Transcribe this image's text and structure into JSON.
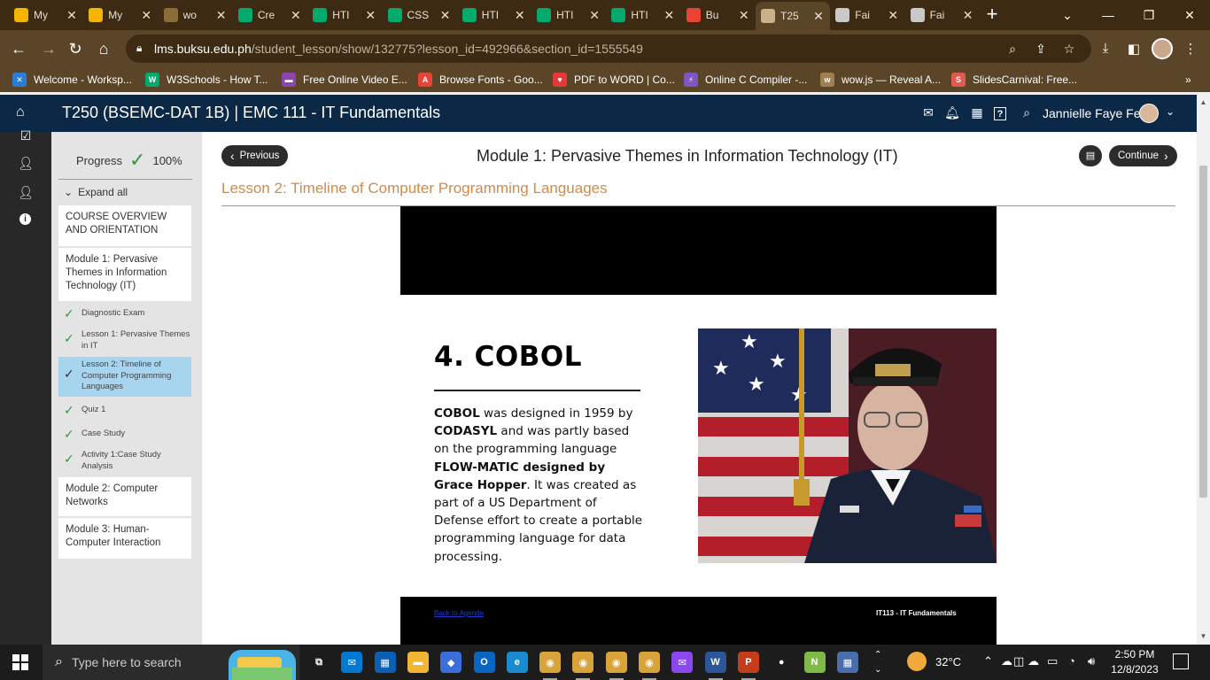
{
  "browser": {
    "tabs": [
      {
        "label": "My",
        "icon": "drive",
        "color": "#f4b400"
      },
      {
        "label": "My",
        "icon": "drive",
        "color": "#f4b400"
      },
      {
        "label": "wo",
        "icon": "image",
        "color": "#8a6d3b"
      },
      {
        "label": "Cre",
        "icon": "w3schools",
        "color": "#04aa6d"
      },
      {
        "label": "HTI",
        "icon": "w3schools",
        "color": "#04aa6d"
      },
      {
        "label": "CSS",
        "icon": "w3schools",
        "color": "#04aa6d"
      },
      {
        "label": "HTI",
        "icon": "w3schools",
        "color": "#04aa6d"
      },
      {
        "label": "HTI",
        "icon": "w3schools",
        "color": "#04aa6d"
      },
      {
        "label": "HTI",
        "icon": "w3schools",
        "color": "#04aa6d"
      },
      {
        "label": "Bu",
        "icon": "gmail",
        "color": "#ea4335"
      },
      {
        "label": "T25",
        "icon": "lms",
        "color": "#c9b28a"
      },
      {
        "label": "Fai",
        "icon": "globe",
        "color": "#c9c9c9"
      },
      {
        "label": "Fai",
        "icon": "globe",
        "color": "#c9c9c9"
      }
    ],
    "active_tab_index": 10,
    "new_tab": "+",
    "url_host": "lms.buksu.edu.ph",
    "url_path": "/student_lesson/show/132775?lesson_id=492966&section_id=1555549",
    "bookmarks": [
      {
        "label": "Welcome - Worksp...",
        "color": "#2b7cd3",
        "glyph": "✕"
      },
      {
        "label": "W3Schools - How T...",
        "color": "#04aa6d",
        "glyph": "W"
      },
      {
        "label": "Free Online Video E...",
        "color": "#8e44ad",
        "glyph": "▬"
      },
      {
        "label": "Browse Fonts - Goo...",
        "color": "#ea4335",
        "glyph": "A"
      },
      {
        "label": "PDF to WORD | Co...",
        "color": "#e53935",
        "glyph": "♥"
      },
      {
        "label": "Online C Compiler -...",
        "color": "#7e57c2",
        "glyph": "⚡"
      },
      {
        "label": "wow.js — Reveal A...",
        "color": "#a08050",
        "glyph": "w"
      },
      {
        "label": "SlidesCarnival: Free...",
        "color": "#e05a4f",
        "glyph": "S"
      }
    ],
    "more_bookmarks": "»"
  },
  "lms": {
    "course_title": "T250 (BSEMC-DAT 1B) | EMC 111 - IT Fundamentals",
    "user_name": "Jannielle Faye Fe...",
    "progress_label": "Progress",
    "progress_value": "100%",
    "progress_fraction": 1.0,
    "expand_all": "Expand all",
    "modules": [
      {
        "title": "COURSE OVERVIEW AND ORIENTATION"
      },
      {
        "title": "Module 1: Pervasive Themes in Information Technology (IT)"
      },
      {
        "title": "Module 2: Computer Networks"
      },
      {
        "title": "Module 3: Human-Computer Interaction"
      }
    ],
    "lessons": [
      {
        "title": "Diagnostic Exam",
        "done": true
      },
      {
        "title": "Lesson 1: Pervasive Themes in IT",
        "done": true
      },
      {
        "title": "Lesson 2: Timeline of Computer Programming Languages",
        "done": true,
        "current": true
      },
      {
        "title": "Quiz 1",
        "done": true
      },
      {
        "title": "Case Study",
        "done": true
      },
      {
        "title": "Activity 1:Case Study Analysis",
        "done": true
      }
    ],
    "previous": "Previous",
    "continue": "Continue",
    "module_heading": "Module 1: Pervasive Themes in Information Technology (IT)",
    "lesson_heading": "Lesson 2: Timeline of Computer Programming Languages"
  },
  "slide": {
    "heading": "4. COBOL",
    "body_parts": [
      {
        "t": "COBOL",
        "b": true
      },
      {
        "t": " was designed in 1959 by ",
        "b": false
      },
      {
        "t": "CODASYL",
        "b": true
      },
      {
        "t": " and was partly based on the programming language ",
        "b": false
      },
      {
        "t": "FLOW-MATIC designed by Grace Hopper",
        "b": true
      },
      {
        "t": ". It was created as part of a US Department of Defense effort to create a portable programming language for data processing.",
        "b": false
      }
    ],
    "back_link": "Back to Agenda",
    "footer_course": "IT113 - IT Fundamentals"
  },
  "taskbar": {
    "search_placeholder": "Type here to search",
    "temperature": "32°C",
    "time": "2:50 PM",
    "date": "12/8/2023",
    "apps": [
      {
        "name": "task-view",
        "color": "#1c1c1c",
        "glyph": "⧉"
      },
      {
        "name": "mail",
        "color": "#0078d4",
        "glyph": "✉"
      },
      {
        "name": "store",
        "color": "#0a5fb4",
        "glyph": "▦"
      },
      {
        "name": "file-explorer",
        "color": "#f2b632",
        "glyph": "▬"
      },
      {
        "name": "vpn",
        "color": "#3b6ed9",
        "glyph": "◆"
      },
      {
        "name": "outlook",
        "color": "#0a64c2",
        "glyph": "O"
      },
      {
        "name": "edge",
        "color": "#1a8bd0",
        "glyph": "e"
      },
      {
        "name": "chrome",
        "color": "#d9a33b",
        "glyph": "◉"
      },
      {
        "name": "chrome",
        "color": "#d9a33b",
        "glyph": "◉"
      },
      {
        "name": "chrome",
        "color": "#d9a33b",
        "glyph": "◉"
      },
      {
        "name": "chrome",
        "color": "#d9a33b",
        "glyph": "◉"
      },
      {
        "name": "messenger",
        "color": "#8a48f0",
        "glyph": "✉"
      },
      {
        "name": "word",
        "color": "#2b579a",
        "glyph": "W"
      },
      {
        "name": "powerpoint",
        "color": "#c43e1c",
        "glyph": "P"
      },
      {
        "name": "recorder",
        "color": "#1c1c1c",
        "glyph": "●"
      },
      {
        "name": "notepad-plus",
        "color": "#7fb947",
        "glyph": "N"
      },
      {
        "name": "calculator",
        "color": "#4a6ea9",
        "glyph": "▦"
      }
    ]
  },
  "colors": {
    "tabbar": "#3c2a12",
    "toolbar": "#5a4528",
    "lms_header": "#0b2846",
    "lesson_accent": "#d08a4a",
    "check_green": "#2e9a3a",
    "current_lesson_bg": "#a7d4ee"
  }
}
